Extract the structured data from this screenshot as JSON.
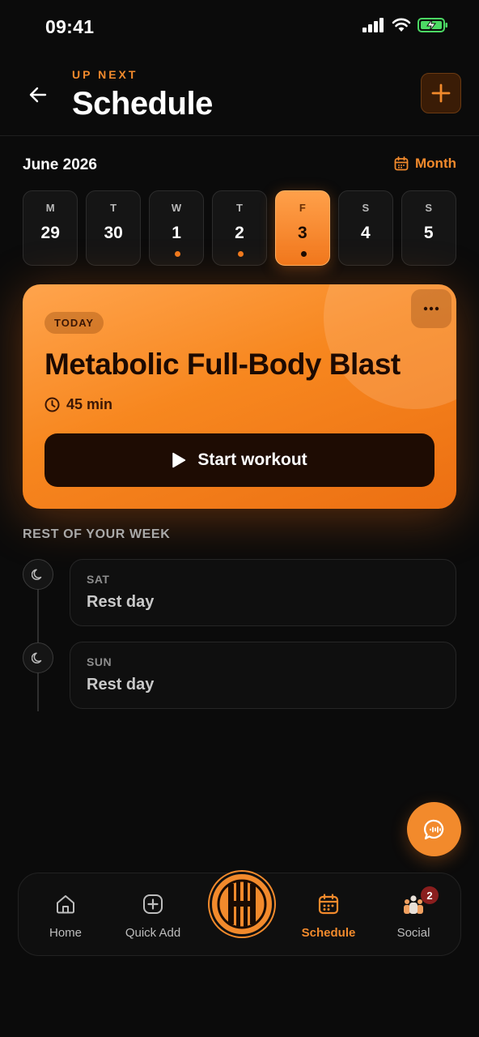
{
  "status_bar": {
    "time": "09:41"
  },
  "header": {
    "eyebrow": "UP NEXT",
    "title": "Schedule"
  },
  "calendar": {
    "month_label": "June 2026",
    "view_toggle": "Month",
    "days": [
      {
        "dow": "M",
        "num": "29",
        "has_event": false,
        "selected": false
      },
      {
        "dow": "T",
        "num": "30",
        "has_event": false,
        "selected": false
      },
      {
        "dow": "W",
        "num": "1",
        "has_event": true,
        "selected": false
      },
      {
        "dow": "T",
        "num": "2",
        "has_event": true,
        "selected": false
      },
      {
        "dow": "F",
        "num": "3",
        "has_event": true,
        "selected": true
      },
      {
        "dow": "S",
        "num": "4",
        "has_event": false,
        "selected": false
      },
      {
        "dow": "S",
        "num": "5",
        "has_event": false,
        "selected": false
      }
    ]
  },
  "workout": {
    "badge": "TODAY",
    "title": "Metabolic Full-Body Blast",
    "duration": "45 min",
    "start_label": "Start workout"
  },
  "rest_of_week": {
    "title": "REST OF YOUR WEEK",
    "items": [
      {
        "day": "SAT",
        "label": "Rest day"
      },
      {
        "day": "SUN",
        "label": "Rest day"
      }
    ]
  },
  "nav": {
    "home": "Home",
    "quick_add": "Quick Add",
    "schedule": "Schedule",
    "social": "Social",
    "social_badge": "2"
  },
  "colors": {
    "accent": "#f28a2c",
    "background": "#0b0b0b"
  }
}
